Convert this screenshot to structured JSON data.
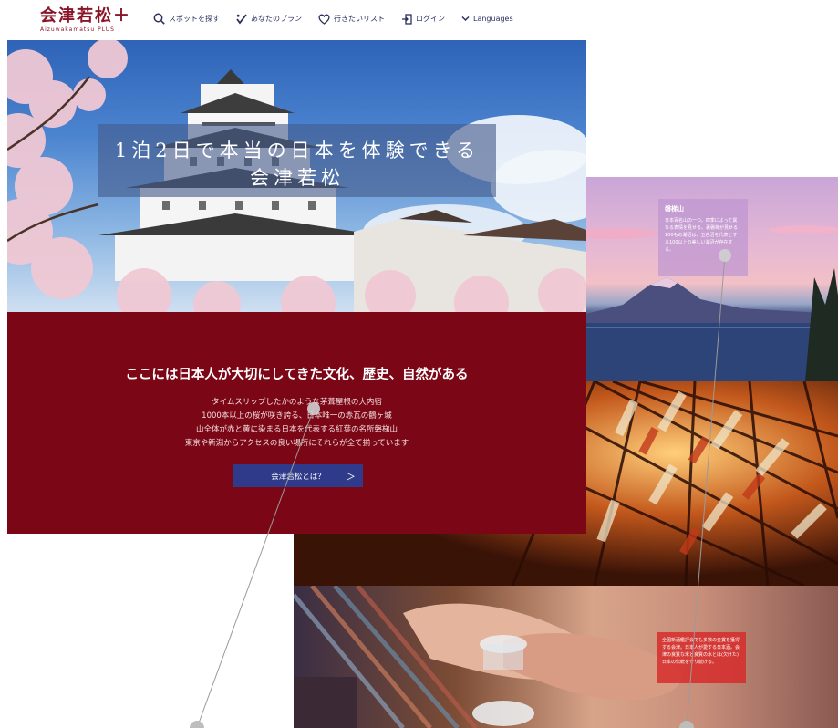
{
  "header": {
    "logo_text": "会津若松＋",
    "logo_sub": "Aizuwakamatsu PLUS",
    "nav": [
      {
        "label": "スポットを探す",
        "icon": "search-icon"
      },
      {
        "label": "あなたのプラン",
        "icon": "plan-icon"
      },
      {
        "label": "行きたいリスト",
        "icon": "heart-icon"
      },
      {
        "label": "ログイン",
        "icon": "login-icon"
      },
      {
        "label": "Languages",
        "icon": "chevron-down-icon"
      }
    ]
  },
  "hero": {
    "title_line1": "1泊2日で本当の日本を体験できる",
    "title_line2": "会津若松"
  },
  "band": {
    "heading": "ここには日本人が大切にしてきた文化、歴史、自然がある",
    "lines": [
      "タイムスリップしたかのような茅葺屋根の大内宿",
      "1000本以上の桜が咲き誇る、日本唯一の赤瓦の鶴ヶ城",
      "山全体が赤と黄に染まる日本を代表する紅葉の名所磐梯山",
      "東京や新潟からアクセスの良い場所にそれらが全て揃っています"
    ],
    "button_label": "会津若松とは？",
    "button_chevron": "＞"
  },
  "photos": {
    "mountain_caption_title": "磐梯山",
    "mountain_caption_text": "日本百名山の一つ。四季によって異なる表情を見せる。裏磐梯が見せる100もの湖沼は、五色沼を代表とする100以上の美しい湖沼が存在する。",
    "sake_caption_text": "全国新酒鑑評会でも多数の金賞を獲得する会津。日本人が愛する日本酒。会津の良質な米と良質の水とは(欠けた)日本の伝統を守り続ける。"
  },
  "colors": {
    "brand": "#8a1528",
    "band_bg": "#7b0716",
    "button_bg": "#2f3a8a",
    "nav_text": "#2b2f5e"
  }
}
